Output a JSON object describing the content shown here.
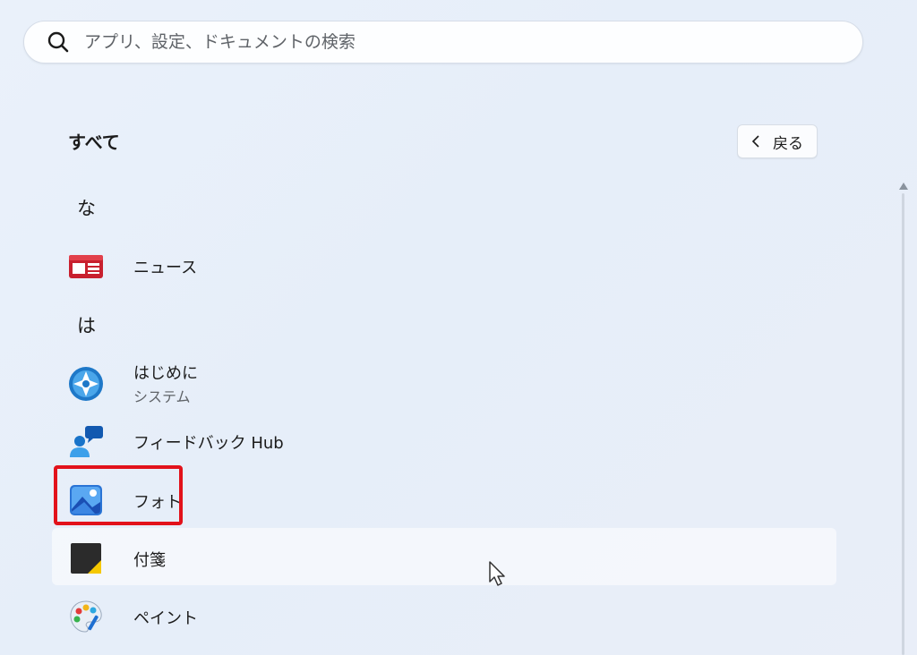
{
  "search": {
    "placeholder": "アプリ、設定、ドキュメントの検索",
    "value": ""
  },
  "header": {
    "title": "すべて",
    "back_label": "戻る"
  },
  "groups": [
    {
      "letter": "な",
      "apps": [
        {
          "name": "ニュース",
          "icon": "news-icon"
        }
      ]
    },
    {
      "letter": "は",
      "apps": [
        {
          "name": "はじめに",
          "subtitle": "システム",
          "icon": "get-started-icon"
        },
        {
          "name": "フィードバック Hub",
          "icon": "feedback-hub-icon"
        },
        {
          "name": "フォト",
          "icon": "photos-icon",
          "highlighted": true
        },
        {
          "name": "付箋",
          "icon": "sticky-notes-icon",
          "hovered": true
        },
        {
          "name": "ペイント",
          "icon": "paint-icon"
        }
      ]
    }
  ],
  "colors": {
    "highlight_border": "#e2121b",
    "accent": "#0067c0"
  }
}
